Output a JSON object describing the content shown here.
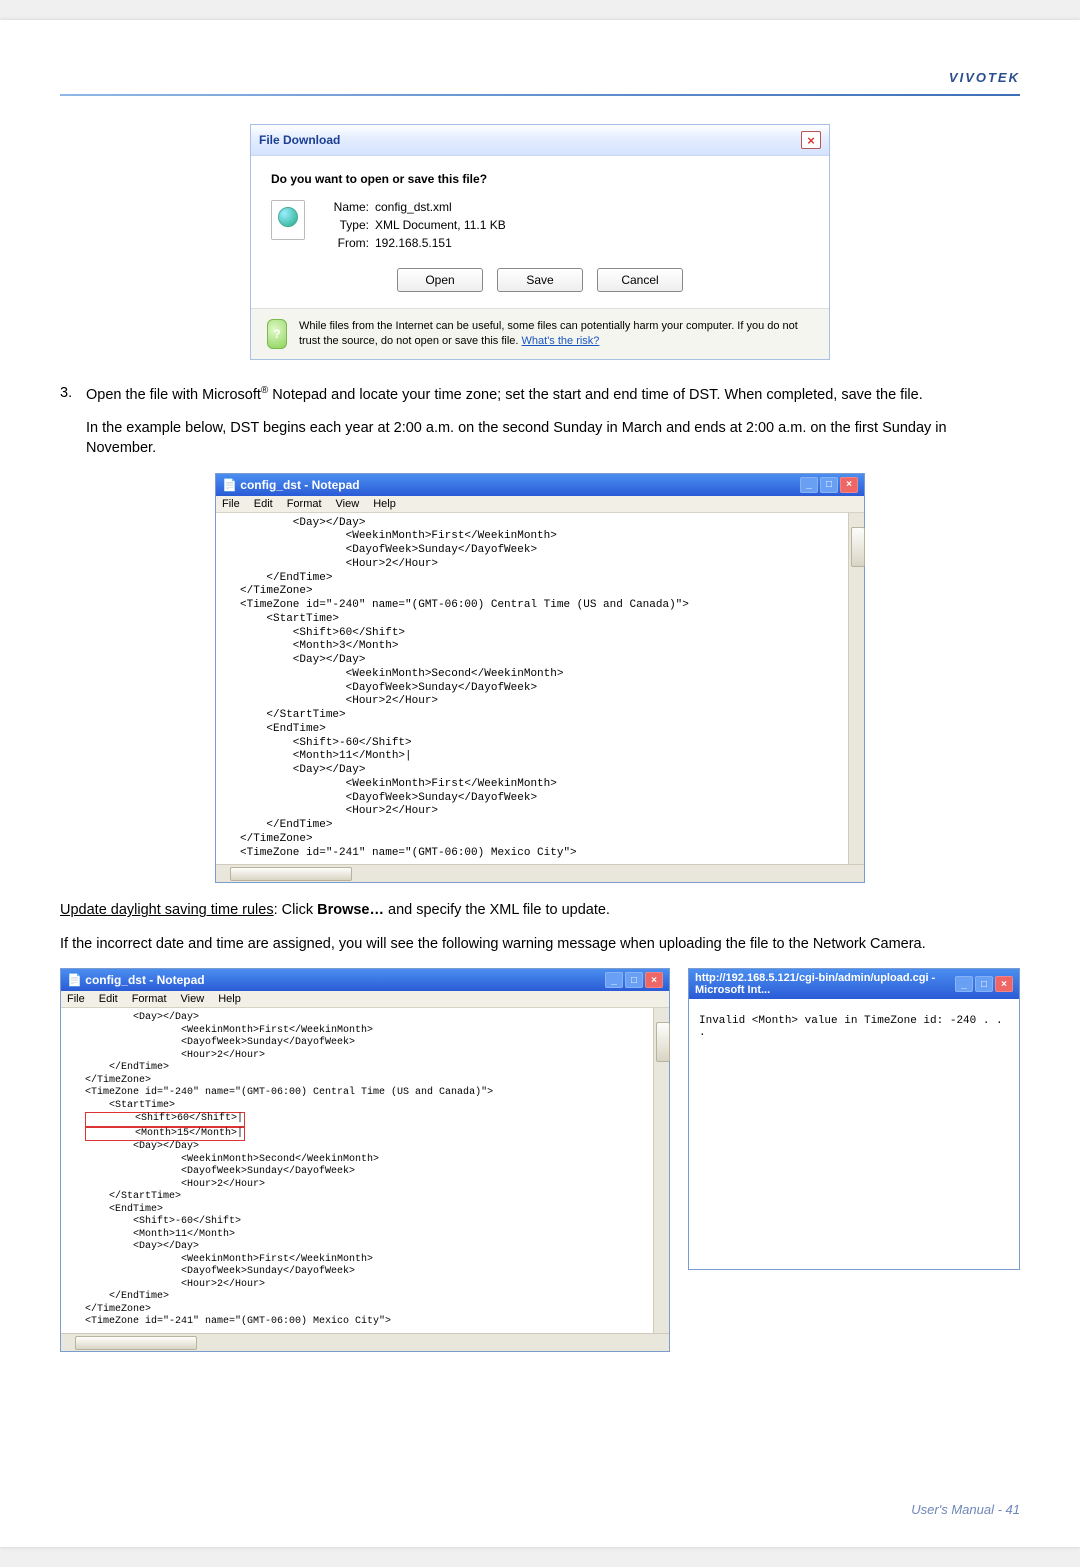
{
  "brand": "VIVOTEK",
  "fileDownload": {
    "title": "File Download",
    "question": "Do you want to open or save this file?",
    "name_label": "Name:",
    "name": "config_dst.xml",
    "type_label": "Type:",
    "type": "XML Document, 11.1 KB",
    "from_label": "From:",
    "from": "192.168.5.151",
    "btn_open": "Open",
    "btn_save": "Save",
    "btn_cancel": "Cancel",
    "warn_text": "While files from the Internet can be useful, some files can potentially harm your computer. If you do not trust the source, do not open or save this file. ",
    "warn_link": "What's the risk?"
  },
  "step3_num": "3.",
  "step3_text_a": "Open the file with Microsoft",
  "step3_reg": "®",
  "step3_text_b": " Notepad and locate your time zone; set the start and end time of DST. When completed, save the file.",
  "example_para": "In the example below, DST begins each year at 2:00 a.m. on the second Sunday in March and ends at 2:00 a.m. on the first Sunday in November.",
  "notepad": {
    "title_prefix": "config_dst - Notepad",
    "menu": [
      "File",
      "Edit",
      "Format",
      "View",
      "Help"
    ],
    "body1": "        <Day></Day>\n                <WeekinMonth>First</WeekinMonth>\n                <DayofWeek>Sunday</DayofWeek>\n                <Hour>2</Hour>\n    </EndTime>\n</TimeZone>\n<TimeZone id=\"-240\" name=\"(GMT-06:00) Central Time (US and Canada)\">\n    <StartTime>\n        <Shift>60</Shift>\n        <Month>3</Month>\n        <Day></Day>\n                <WeekinMonth>Second</WeekinMonth>\n                <DayofWeek>Sunday</DayofWeek>\n                <Hour>2</Hour>\n    </StartTime>\n    <EndTime>\n        <Shift>-60</Shift>\n        <Month>11</Month>|\n        <Day></Day>\n                <WeekinMonth>First</WeekinMonth>\n                <DayofWeek>Sunday</DayofWeek>\n                <Hour>2</Hour>\n    </EndTime>\n</TimeZone>\n<TimeZone id=\"-241\" name=\"(GMT-06:00) Mexico City\">",
    "body2_a": "        <Day></Day>\n                <WeekinMonth>First</WeekinMonth>\n                <DayofWeek>Sunday</DayofWeek>\n                <Hour>2</Hour>\n    </EndTime>\n</TimeZone>\n<TimeZone id=\"-240\" name=\"(GMT-06:00) Central Time (US and Canada)\">\n    <StartTime>",
    "body2_hl1": "        <Shift>60</Shift>|",
    "body2_hl2": "        <Month>15</Month>|",
    "body2_b": "        <Day></Day>\n                <WeekinMonth>Second</WeekinMonth>\n                <DayofWeek>Sunday</DayofWeek>\n                <Hour>2</Hour>\n    </StartTime>\n    <EndTime>\n        <Shift>-60</Shift>\n        <Month>11</Month>\n        <Day></Day>\n                <WeekinMonth>First</WeekinMonth>\n                <DayofWeek>Sunday</DayofWeek>\n                <Hour>2</Hour>\n    </EndTime>\n</TimeZone>\n<TimeZone id=\"-241\" name=\"(GMT-06:00) Mexico City\">"
  },
  "update_para_a": "Update daylight saving time rules",
  "update_para_b": ": Click ",
  "update_browse": "Browse…",
  "update_para_c": " and specify the XML file to update.",
  "incorrect_para": "If the incorrect date and time are assigned, you will see the following warning message when uploading the file to the Network Camera.",
  "ie": {
    "title": "http://192.168.5.121/cgi-bin/admin/upload.cgi - Microsoft Int...",
    "body": "Invalid <Month> value in TimeZone id: -240 . . ."
  },
  "footer_a": "User's Manual - ",
  "footer_b": "41"
}
